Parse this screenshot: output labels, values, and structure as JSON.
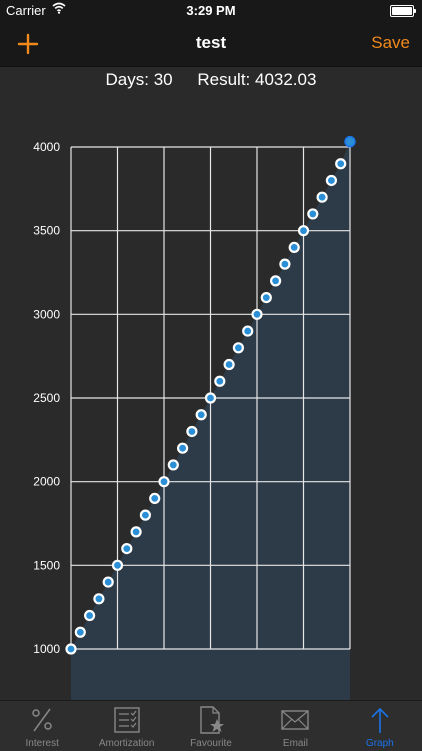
{
  "status_bar": {
    "carrier": "Carrier",
    "time": "3:29 PM"
  },
  "nav": {
    "title": "test",
    "save_label": "Save",
    "add_icon": "plus-icon"
  },
  "summary": {
    "days_label": "Days: 30",
    "result_label": "Result: 4032.03"
  },
  "colors": {
    "accent": "#f08a1c",
    "point": "#2a8fd6",
    "fill": "#2d3b48",
    "active_tab": "#1a73e8"
  },
  "chart_data": {
    "type": "area",
    "title": "",
    "xlabel": "",
    "ylabel": "",
    "ylim": [
      1000,
      4000
    ],
    "yticks": [
      "1000",
      "1500",
      "2000",
      "2500",
      "3000",
      "3500",
      "4000"
    ],
    "grid": true,
    "x": [
      0,
      1,
      2,
      3,
      4,
      5,
      6,
      7,
      8,
      9,
      10,
      11,
      12,
      13,
      14,
      15,
      16,
      17,
      18,
      19,
      20,
      21,
      22,
      23,
      24,
      25,
      26,
      27,
      28,
      29,
      30
    ],
    "values": [
      1000,
      1100,
      1200,
      1300,
      1400,
      1500,
      1600,
      1700,
      1800,
      1900,
      2000,
      2100,
      2200,
      2300,
      2400,
      2500,
      2600,
      2700,
      2800,
      2900,
      3000,
      3100,
      3200,
      3300,
      3400,
      3500,
      3600,
      3700,
      3800,
      3900,
      4032.03
    ]
  },
  "tabs": [
    {
      "label": "Interest",
      "icon": "percent-icon",
      "active": false
    },
    {
      "label": "Amortization",
      "icon": "checklist-icon",
      "active": false
    },
    {
      "label": "Favourite",
      "icon": "document-star-icon",
      "active": false
    },
    {
      "label": "Email",
      "icon": "envelope-icon",
      "active": false
    },
    {
      "label": "Graph",
      "icon": "arrow-up-icon",
      "active": true
    }
  ]
}
